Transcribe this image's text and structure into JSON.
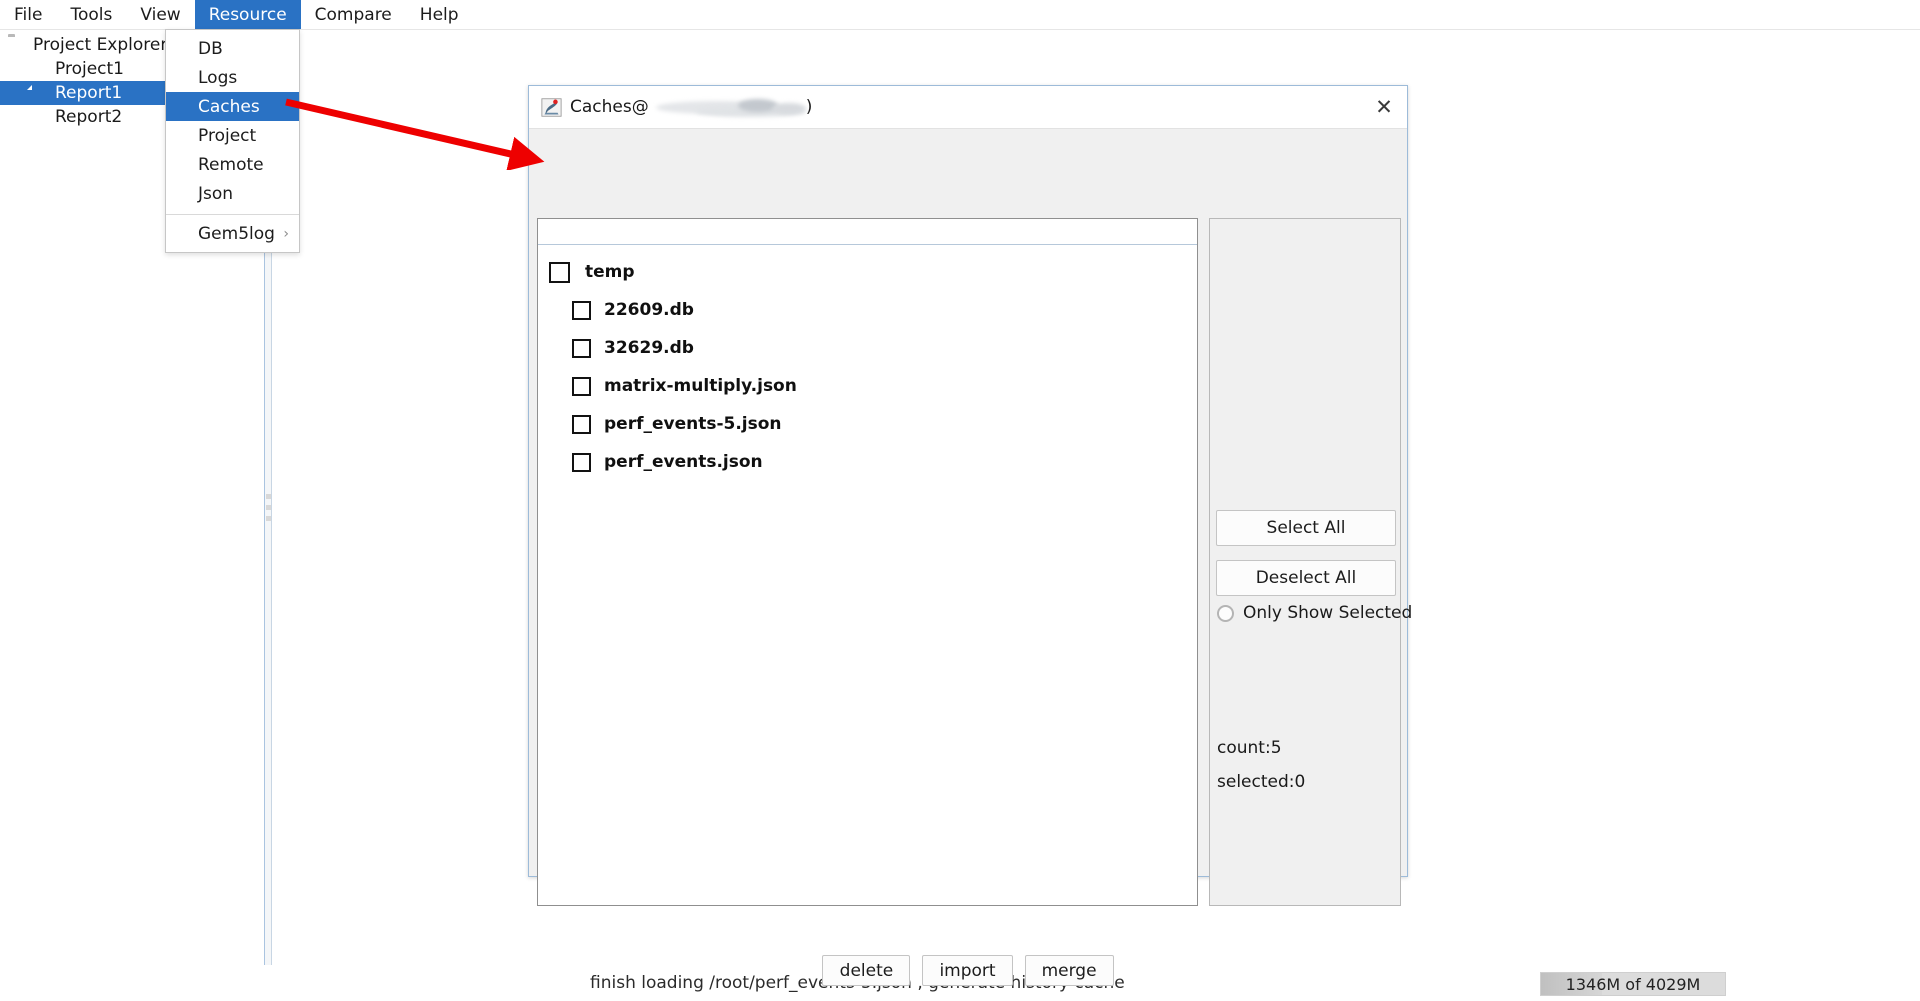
{
  "menubar": {
    "items": [
      {
        "label": "File",
        "active": false
      },
      {
        "label": "Tools",
        "active": false
      },
      {
        "label": "View",
        "active": false
      },
      {
        "label": "Resource",
        "active": true
      },
      {
        "label": "Compare",
        "active": false
      },
      {
        "label": "Help",
        "active": false
      }
    ]
  },
  "resource_menu": {
    "items": [
      {
        "label": "DB",
        "highlighted": false,
        "submenu": false
      },
      {
        "label": "Logs",
        "highlighted": false,
        "submenu": false
      },
      {
        "label": "Caches",
        "highlighted": true,
        "submenu": false
      },
      {
        "label": "Project",
        "highlighted": false,
        "submenu": false
      },
      {
        "label": "Remote",
        "highlighted": false,
        "submenu": false
      },
      {
        "label": "Json",
        "highlighted": false,
        "submenu": false
      }
    ],
    "submenu_item": {
      "label": "Gem5log",
      "arrow": "›"
    }
  },
  "project_explorer": {
    "root_label": "Project Explorer",
    "nodes": [
      {
        "label": "Project1",
        "selected": false
      },
      {
        "label": "Report1",
        "selected": true
      },
      {
        "label": "Report2",
        "selected": false
      }
    ]
  },
  "dialog": {
    "title_prefix": "Caches@",
    "title_suffix": ")",
    "close_label": "✕",
    "filter_value": "",
    "filter_placeholder": "",
    "tree": [
      {
        "label": "temp",
        "level": 0,
        "checked": false
      },
      {
        "label": "22609.db",
        "level": 1,
        "checked": false
      },
      {
        "label": "32629.db",
        "level": 1,
        "checked": false
      },
      {
        "label": "matrix-multiply.json",
        "level": 1,
        "checked": false
      },
      {
        "label": "perf_events-5.json",
        "level": 1,
        "checked": false
      },
      {
        "label": "perf_events.json",
        "level": 1,
        "checked": false
      }
    ],
    "side": {
      "select_all": "Select All",
      "deselect_all": "Deselect All",
      "only_show_selected": "Only Show Selected",
      "only_show_selected_checked": false,
      "count": "count:5",
      "selected": "selected:0"
    },
    "buttons": [
      {
        "label": "delete"
      },
      {
        "label": "import"
      },
      {
        "label": "merge"
      }
    ]
  },
  "statusbar": {
    "message": "finish loading /root/perf_events-5.json , generate history cache",
    "memory": "1346M of 4029M"
  },
  "colors": {
    "accent": "#2a72c4",
    "annotation_arrow": "#ee0000",
    "dialog_border": "#9dbbd9",
    "window_bg": "#ffffff",
    "panel_bg": "#f0f0f0"
  }
}
